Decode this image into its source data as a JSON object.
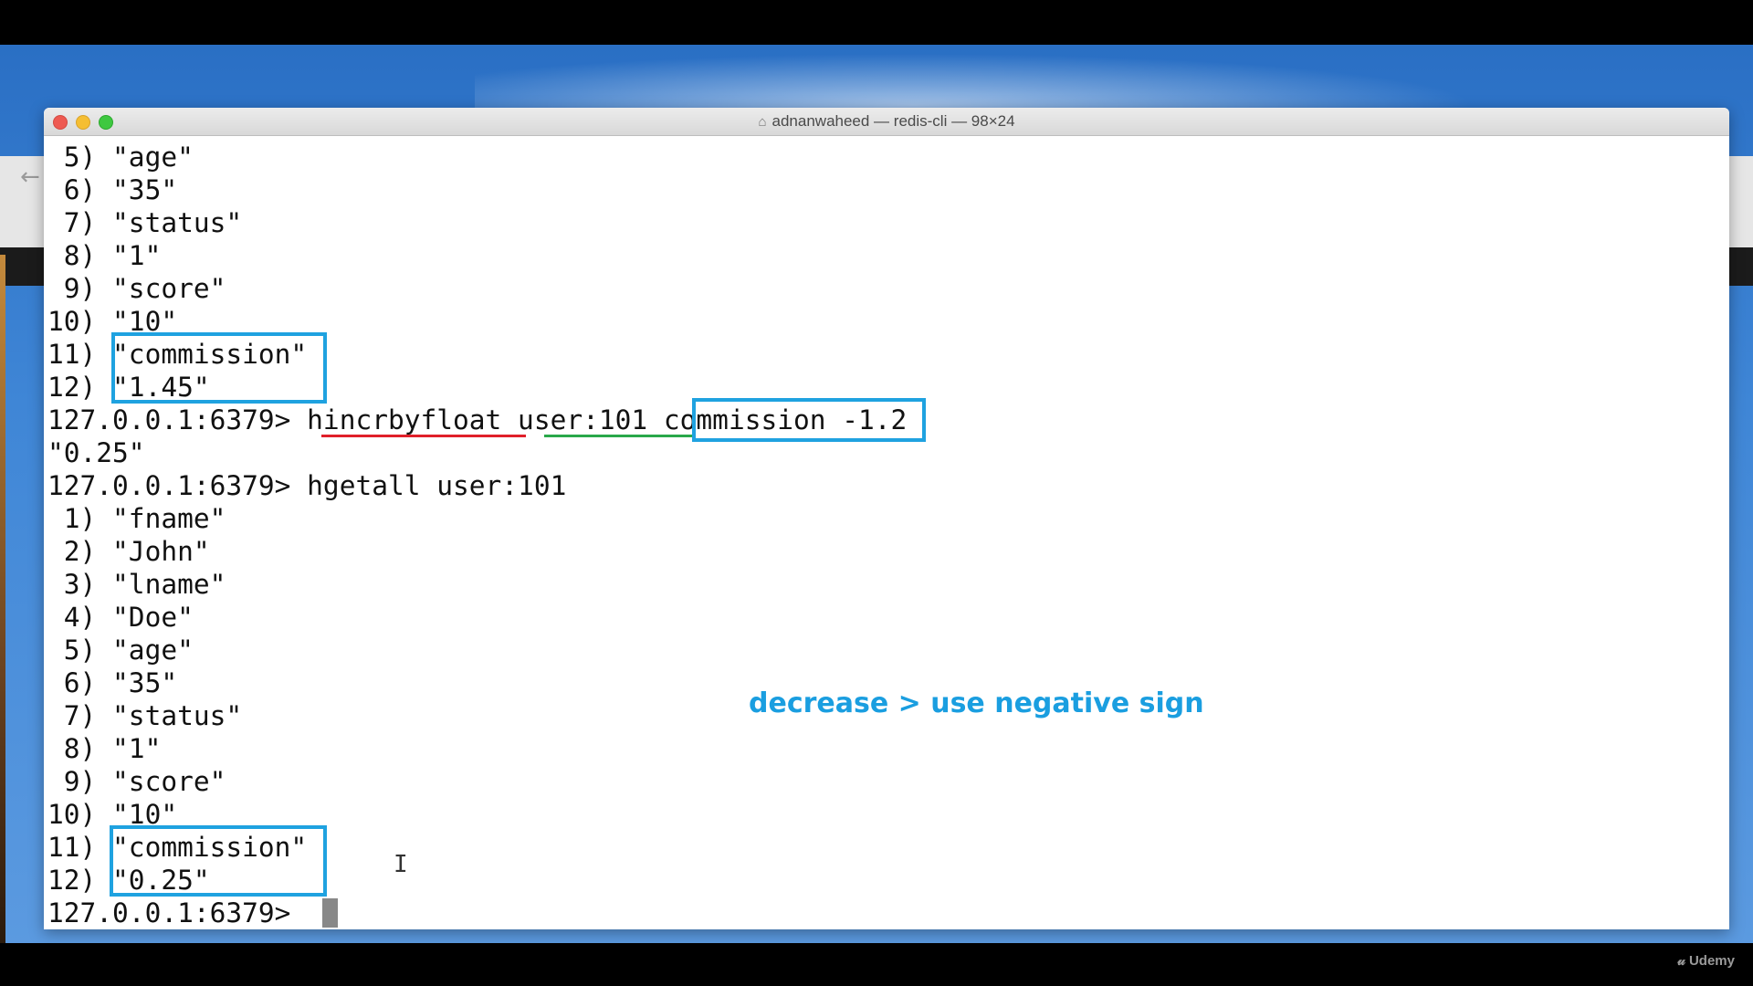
{
  "window": {
    "title": "adnanwaheed — redis-cli — 98×24"
  },
  "terminal_lines": [
    " 5) \"age\"",
    " 6) \"35\"",
    " 7) \"status\"",
    " 8) \"1\"",
    " 9) \"score\"",
    "10) \"10\"",
    "11) \"commission\"",
    "12) \"1.45\"",
    "127.0.0.1:6379> hincrbyfloat user:101 commission -1.2",
    "\"0.25\"",
    "127.0.0.1:6379> hgetall user:101",
    " 1) \"fname\"",
    " 2) \"John\"",
    " 3) \"lname\"",
    " 4) \"Doe\"",
    " 5) \"age\"",
    " 6) \"35\"",
    " 7) \"status\"",
    " 8) \"1\"",
    " 9) \"score\"",
    "10) \"10\"",
    "11) \"commission\"",
    "12) \"0.25\"",
    "127.0.0.1:6379> "
  ],
  "annotation": "decrease > use negative sign",
  "watermark": "Udemy",
  "colors": {
    "highlight_box": "#1fa2e0",
    "underline_command": "#e0202a",
    "underline_key": "#2aa84a",
    "annotation": "#1a9ee0"
  },
  "icons": {
    "window_title_icon": "home-icon",
    "cursor": "text-ibeam-icon"
  }
}
